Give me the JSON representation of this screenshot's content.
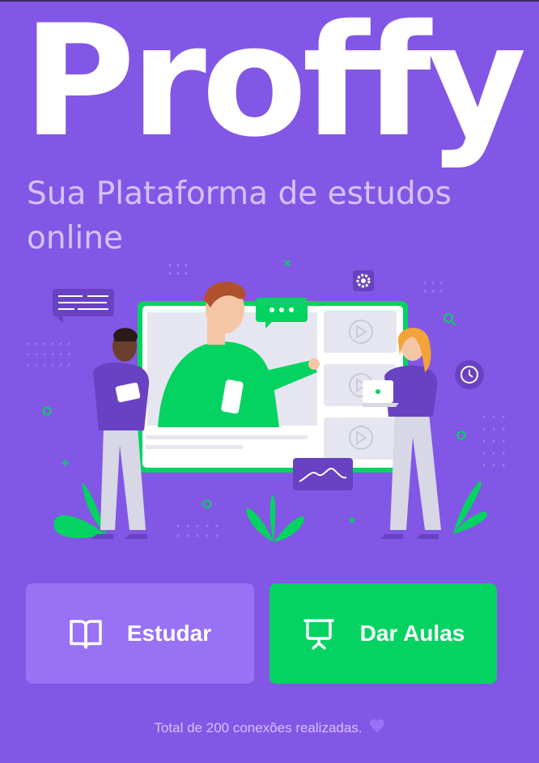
{
  "app": {
    "logo_text": "Proffy",
    "tagline": "Sua Plataforma de estudos online"
  },
  "actions": {
    "study_label": "Estudar",
    "teach_label": "Dar Aulas"
  },
  "footer": {
    "connections_text": "Total de 200 conexões realizadas."
  },
  "icons": {
    "study": "book-open-icon",
    "teach": "presentation-board-icon",
    "footer": "heart-icon"
  },
  "colors": {
    "background": "#8257E5",
    "study_button": "#9871F5",
    "teach_button": "#04D361",
    "text_light": "#D4C2FF"
  }
}
